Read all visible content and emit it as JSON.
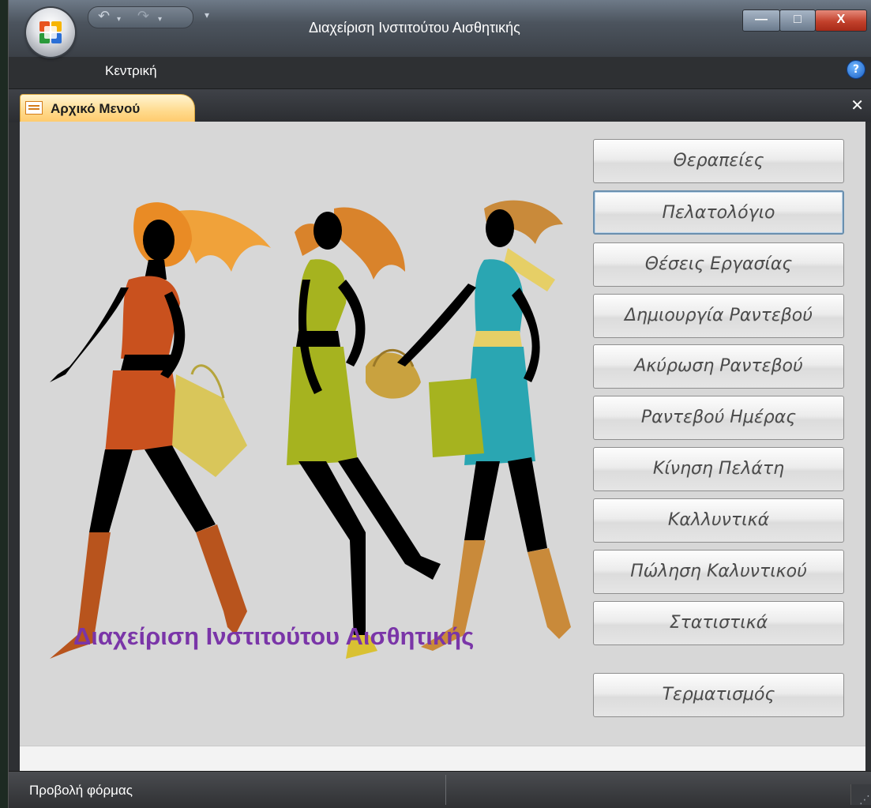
{
  "window": {
    "title": "Διαχείριση Ινστιτούτου Αισθητικής",
    "ribbon_tab": "Κεντρική",
    "controls": {
      "minimize": "—",
      "maximize": "□",
      "close": "X"
    },
    "help": "?"
  },
  "quick_access": {
    "undo": "↶",
    "undo_arrow": "▾",
    "redo": "↷",
    "redo_arrow": "▾",
    "customize": "▾"
  },
  "document_tab": {
    "label": "Αρχικό Μενού",
    "close": "✕"
  },
  "form": {
    "title": "Διαχείριση Ινστιτούτου Αισθητικής",
    "buttons": [
      "Θεραπείες",
      "Πελατολόγιο",
      "Θέσεις Εργασίας",
      "Δημιουργία Ραντεβού",
      "Ακύρωση Ραντεβού",
      "Ραντεβού Ημέρας",
      "Κίνηση Πελάτη",
      "Καλλυντικά",
      "Πώληση Καλυντικού",
      "Στατιστικά",
      "Τερματισμός"
    ]
  },
  "statusbar": {
    "text": "Προβολή φόρμας",
    "grip": "⋰"
  },
  "colors": {
    "title_purple": "#7a35a8",
    "tab_orange": "#ffc96a",
    "form_bg": "#d7d7d7"
  }
}
